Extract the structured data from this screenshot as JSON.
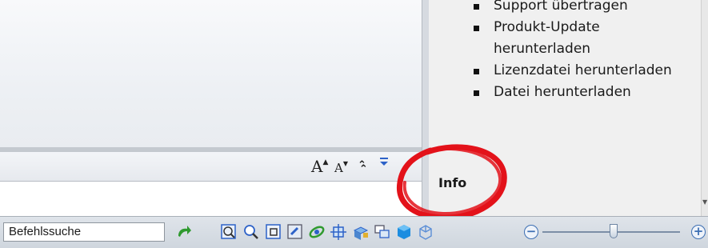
{
  "info_pane": {
    "bullets": [
      "Support übertragen",
      "Produkt-Update herunterladen",
      "Lizenzdatei herunterladen",
      "Datei herunterladen"
    ],
    "info_title": "Info"
  },
  "font_tools": {
    "increase": "A",
    "decrease": "A"
  },
  "statusbar": {
    "command_search": "Befehlssuche",
    "icons": [
      "go-arrow-icon",
      "zoom-window-icon",
      "zoom-realtime-icon",
      "zoom-extents-icon",
      "zoom-previous-icon",
      "orbit-icon",
      "pan-icon",
      "3d-view-icon",
      "window-tile-icon",
      "cube-icon",
      "wireframe-cube-icon"
    ],
    "zoom_level_fraction": 0.52
  },
  "colors": {
    "annotation_red": "#e3121a",
    "toolbar_blue": "#2d62c8"
  }
}
